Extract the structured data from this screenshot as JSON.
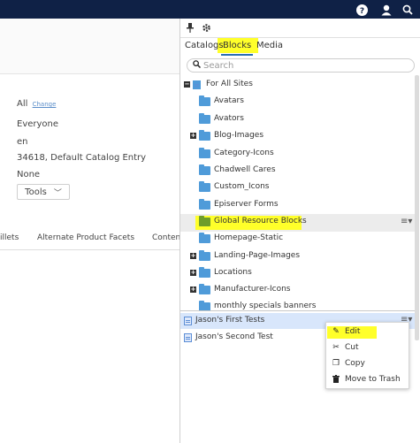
{
  "top_bar": {
    "icons": [
      "help-icon",
      "user-icon",
      "search-icon"
    ]
  },
  "properties": {
    "visible_to_value": "All",
    "change_link": "Change",
    "access_rights": "Everyone",
    "language": "en",
    "id_type": "34618, Default Catalog Entry",
    "markets": "None",
    "tools_label": "Tools"
  },
  "content_tabs": [
    "illets",
    "Alternate Product Facets",
    "Content"
  ],
  "panel": {
    "toolbar_icons": [
      "pin-icon",
      "settings-icon"
    ],
    "tabs": [
      "Catalogs",
      "Blocks",
      "Media"
    ],
    "active_tab": "Blocks",
    "search_placeholder": "Search",
    "tree": {
      "root": "For All Sites",
      "folders": [
        {
          "label": "Avatars",
          "expandable": false
        },
        {
          "label": "Avators",
          "expandable": false
        },
        {
          "label": "Blog-Images",
          "expandable": true
        },
        {
          "label": "Category-Icons",
          "expandable": false
        },
        {
          "label": "Chadwell Cares",
          "expandable": false
        },
        {
          "label": "Custom_Icons",
          "expandable": false
        },
        {
          "label": "Episerver Forms",
          "expandable": false
        },
        {
          "label": "Global Resource Blocks",
          "expandable": false,
          "highlighted": true
        },
        {
          "label": "Homepage-Static",
          "expandable": false
        },
        {
          "label": "Landing-Page-Images",
          "expandable": true
        },
        {
          "label": "Locations",
          "expandable": true
        },
        {
          "label": "Manufacturer-Icons",
          "expandable": true
        },
        {
          "label": "monthly specials banners",
          "expandable": false
        }
      ]
    },
    "blocks": [
      "Jason's First Tests",
      "Jason's Second Test"
    ],
    "context_menu": [
      {
        "label": "Edit",
        "icon": "pencil-icon"
      },
      {
        "label": "Cut",
        "icon": "scissors-icon"
      },
      {
        "label": "Copy",
        "icon": "copy-icon"
      },
      {
        "label": "Move to Trash",
        "icon": "trash-icon"
      }
    ]
  },
  "colors": {
    "top_bar": "#0f2146",
    "highlight": "#ffff2a",
    "folder": "#4f9bd9",
    "folder_selected": "#6e9d2a",
    "selected_row": "#d8e6fb",
    "tab_underline": "#2b6fb4"
  }
}
